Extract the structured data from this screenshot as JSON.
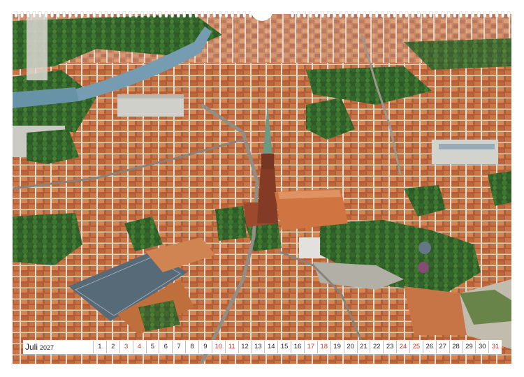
{
  "calendar": {
    "month_label": "Juli",
    "year_label": "2027",
    "days": [
      {
        "n": "1",
        "red": false
      },
      {
        "n": "2",
        "red": false
      },
      {
        "n": "3",
        "red": true
      },
      {
        "n": "4",
        "red": true
      },
      {
        "n": "5",
        "red": false
      },
      {
        "n": "6",
        "red": false
      },
      {
        "n": "7",
        "red": false
      },
      {
        "n": "8",
        "red": false
      },
      {
        "n": "9",
        "red": false
      },
      {
        "n": "10",
        "red": true
      },
      {
        "n": "11",
        "red": true
      },
      {
        "n": "12",
        "red": false
      },
      {
        "n": "13",
        "red": false
      },
      {
        "n": "14",
        "red": false
      },
      {
        "n": "15",
        "red": false
      },
      {
        "n": "16",
        "red": false
      },
      {
        "n": "17",
        "red": true
      },
      {
        "n": "18",
        "red": true
      },
      {
        "n": "19",
        "red": false
      },
      {
        "n": "20",
        "red": false
      },
      {
        "n": "21",
        "red": false
      },
      {
        "n": "22",
        "red": false
      },
      {
        "n": "23",
        "red": false
      },
      {
        "n": "24",
        "red": true
      },
      {
        "n": "25",
        "red": true
      },
      {
        "n": "26",
        "red": false
      },
      {
        "n": "27",
        "red": false
      },
      {
        "n": "28",
        "red": false
      },
      {
        "n": "29",
        "red": false
      },
      {
        "n": "30",
        "red": false
      },
      {
        "n": "31",
        "red": true
      }
    ]
  },
  "colors": {
    "weekend": "#c0392b",
    "text": "#222222"
  }
}
